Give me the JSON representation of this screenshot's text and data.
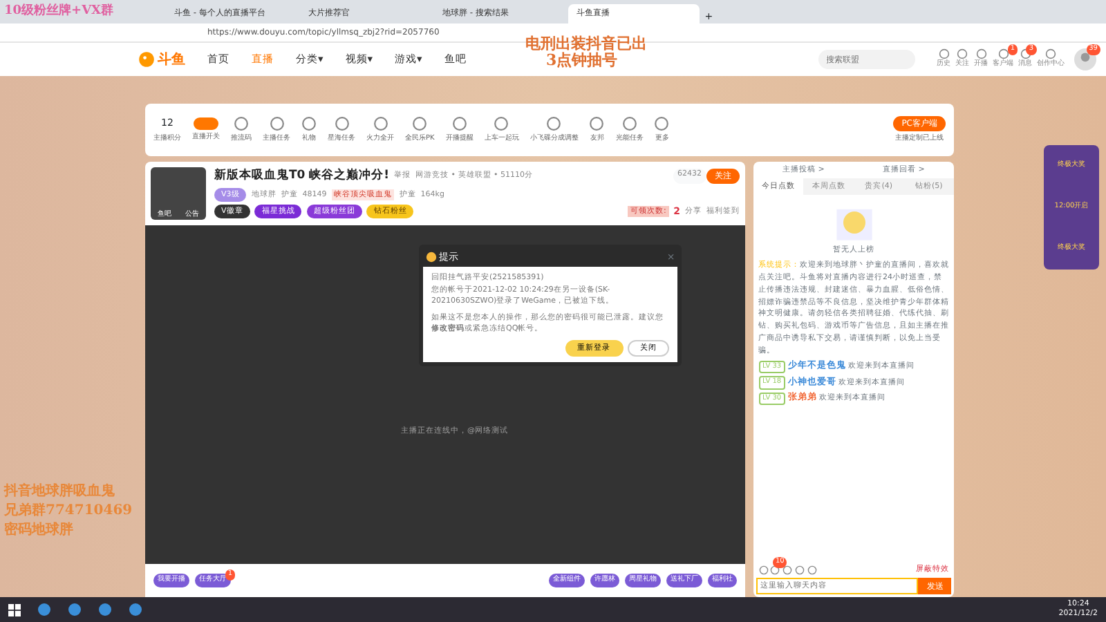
{
  "browser": {
    "tabs": [
      {
        "label": "斗鱼 - 每个人的直播平台",
        "selected": false
      },
      {
        "label": "大片推荐官",
        "selected": false
      },
      {
        "label": "地球胖 - 搜索结果",
        "selected": false
      },
      {
        "label": "斗鱼直播",
        "selected": true
      }
    ],
    "new_tab": "+",
    "address": "https://www.douyu.com/topic/yllmsq_zbj2?rid=2057760"
  },
  "overlay_texts": [
    {
      "kind": "top",
      "text": "10级粉丝牌+VX群"
    },
    {
      "kind": "center",
      "text": "电刑出装抖音已出"
    },
    {
      "kind": "center",
      "text": "3点钟抽号"
    },
    {
      "kind": "left",
      "text": "抖音地球胖吸血鬼"
    },
    {
      "kind": "left",
      "text": "兄弟群774710469"
    },
    {
      "kind": "left",
      "text": "密码地球胖"
    }
  ],
  "site_header": {
    "logo": "斗鱼",
    "nav": [
      {
        "label": "首页",
        "selected": false
      },
      {
        "label": "直播",
        "selected": true
      },
      {
        "label": "分类▾",
        "selected": false
      },
      {
        "label": "视频▾",
        "selected": false
      },
      {
        "label": "游戏▾",
        "selected": false
      },
      {
        "label": "鱼吧",
        "selected": false
      }
    ],
    "search": {
      "placeholder": "搜索联盟"
    },
    "icons": [
      {
        "label": "历史"
      },
      {
        "label": "关注"
      },
      {
        "label": "开播"
      },
      {
        "label": "客户端",
        "badge": "1"
      },
      {
        "label": "消息",
        "badge": "3"
      },
      {
        "label": "创作中心"
      }
    ],
    "avatar_badge": "39"
  },
  "toolbar": {
    "score": "12",
    "score_label": "主播积分",
    "items": [
      {
        "label": "直播开关",
        "on": true
      },
      {
        "label": "推流码"
      },
      {
        "label": "主播任务"
      },
      {
        "label": "礼物"
      },
      {
        "label": "星海任务"
      },
      {
        "label": "火力全开"
      },
      {
        "label": "全民乐PK"
      },
      {
        "label": "开播提醒"
      },
      {
        "label": "上车一起玩"
      },
      {
        "label": "小飞碟分成调整"
      },
      {
        "label": "友邦"
      },
      {
        "label": "光能任务"
      },
      {
        "label": "更多"
      }
    ],
    "client_button": "PC客户端",
    "client_note": "主播定制已上线"
  },
  "room": {
    "title": "新版本吸血鬼T0 峡谷之巅冲分!",
    "report": "举报",
    "category": "网游竞技 • 英雄联盟 • 51110分",
    "level": "V3级",
    "anchor": "地球胖",
    "guard": "护童",
    "heat": "48149",
    "honor": "峡谷顶尖吸血鬼",
    "guard2": "护童",
    "weight": "164kg",
    "avatar_tags": [
      "鱼吧",
      "公告"
    ],
    "badges": [
      {
        "label": "V徽章",
        "color": "#333333"
      },
      {
        "label": "福星挑战",
        "color": "#7b2bd6"
      },
      {
        "label": "超级粉丝团",
        "color": "#8a3ad8"
      },
      {
        "label": "钻石粉丝",
        "color": "#f7c51c"
      }
    ],
    "followers": "62432",
    "follow": "关注",
    "claim": "可领次数:",
    "claim_count": "2",
    "share": "分享",
    "checkin": "福利签到"
  },
  "dialog": {
    "title": "提示",
    "close": "×",
    "lines": [
      "回阳挂气路平安(2521585391)",
      "您的帐号于2021-12-02 10:24:29在另一设备(SK-20210630SZWO)登录了WeGame，已被迫下线。"
    ],
    "warning": "如果这不是您本人的操作，那么您的密码很可能已泄露。建议您**修改密码**或紧急冻结QQ帐号。",
    "buttons": [
      {
        "label": "重新登录",
        "kind": "primary"
      },
      {
        "label": "关闭",
        "kind": "secondary"
      }
    ]
  },
  "video_status": "主播正在连线中，@网络测试",
  "bottom_left": [
    "我要开播",
    "任务大厅"
  ],
  "bottom_right": [
    "全新组件",
    "许愿林",
    "周星礼物",
    "送礼下厂",
    "福利社"
  ],
  "bottom_badge": "1",
  "chat": {
    "links": [
      "主播投稿 >",
      "直播回看 >"
    ],
    "tabs": [
      {
        "label": "今日点数",
        "selected": true
      },
      {
        "label": "本周点数",
        "selected": false
      },
      {
        "label": "贵宾(4)",
        "selected": false
      },
      {
        "label": "钻粉(5)",
        "selected": false
      }
    ],
    "empty": "暂无人上榜",
    "system_label": "系统提示：",
    "system_text": "欢迎来到地球胖丶护童的直播间，喜欢就点关注吧。斗鱼将对直播内容进行24小时巡查，禁止传播违法违规、封建迷信、暴力血腥、低俗色情、招嫖诈骗违禁品等不良信息，坚决维护青少年群体精神文明健康。请勿轻信各类招聘征婚、代练代抽、刷钻、购买礼包码、游戏币等广告信息，且如主播在推广商品中诱导私下交易，请谨慎判断，以免上当受骗。",
    "messages": [
      {
        "level": "LV 33",
        "user": "少年不是色鬼",
        "text": "欢迎来到本直播间",
        "color": "#3d8bd9"
      },
      {
        "level": "LV 18",
        "user": "小神也爱哥",
        "text": "欢迎来到本直播间",
        "color": "#3d8bd9"
      },
      {
        "level": "LV 30",
        "user": "张弟弟",
        "text": "欢迎来到本直播间",
        "color": "#f26b3a"
      }
    ],
    "gift_badge": "10",
    "block_effects": "屏蔽特效",
    "input": {
      "placeholder": "这里输入聊天内容"
    },
    "send": "发送"
  },
  "promo": {
    "title": "终极大奖",
    "time": "12:00开启",
    "sub": "终极大奖"
  },
  "taskbar": {
    "time": "10:24",
    "date": "2021/12/2"
  }
}
